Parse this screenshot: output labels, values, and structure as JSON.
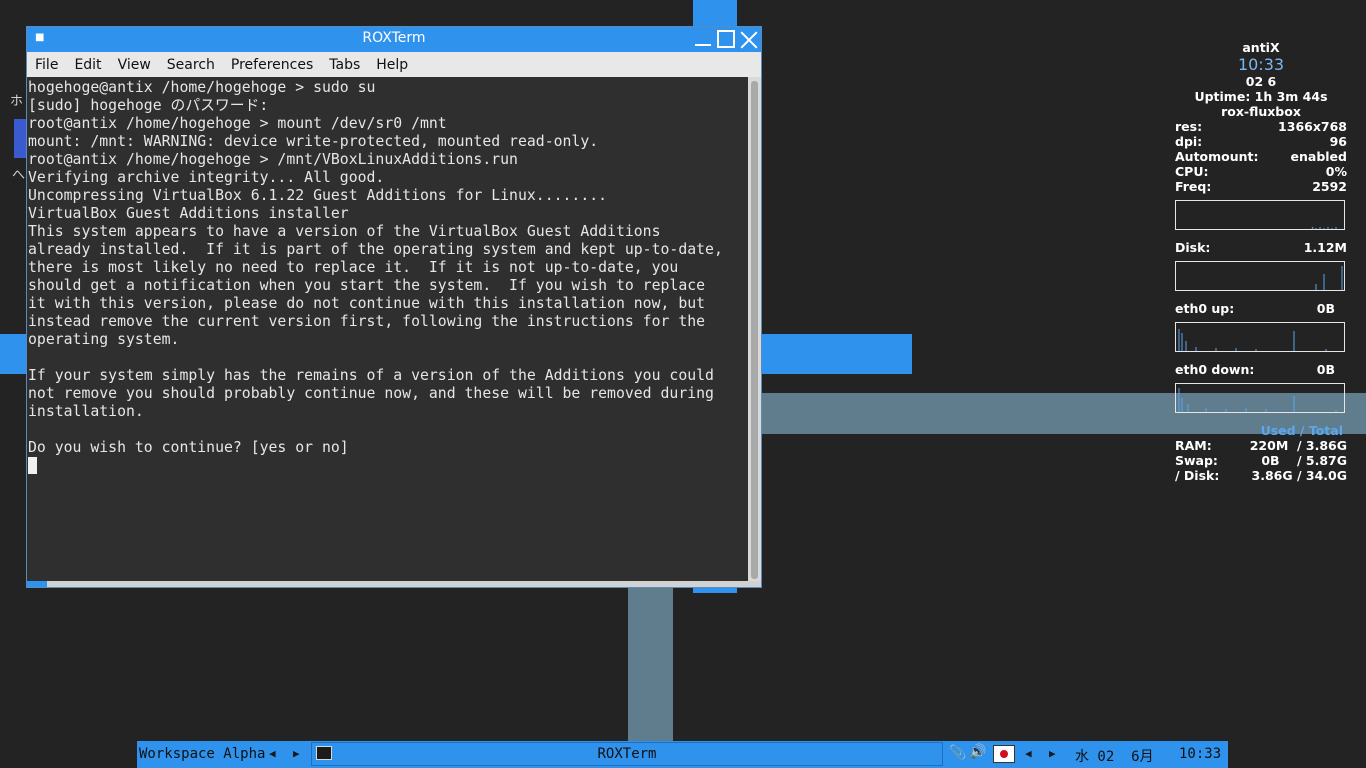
{
  "desktop": {
    "icon_label_1": "ホ",
    "icon_label_2": "へ"
  },
  "window": {
    "title": "ROXTerm",
    "menu": [
      "File",
      "Edit",
      "View",
      "Search",
      "Preferences",
      "Tabs",
      "Help"
    ]
  },
  "terminal": {
    "lines": [
      "hogehoge@antix /home/hogehoge > sudo su",
      "[sudo] hogehoge のパスワード:",
      "root@antix /home/hogehoge > mount /dev/sr0 /mnt",
      "mount: /mnt: WARNING: device write-protected, mounted read-only.",
      "root@antix /home/hogehoge > /mnt/VBoxLinuxAdditions.run",
      "Verifying archive integrity... All good.",
      "Uncompressing VirtualBox 6.1.22 Guest Additions for Linux........",
      "VirtualBox Guest Additions installer",
      "This system appears to have a version of the VirtualBox Guest Additions",
      "already installed.  If it is part of the operating system and kept up-to-date,",
      "there is most likely no need to replace it.  If it is not up-to-date, you",
      "should get a notification when you start the system.  If you wish to replace",
      "it with this version, please do not continue with this installation now, but",
      "instead remove the current version first, following the instructions for the",
      "operating system.",
      "",
      "If your system simply has the remains of a version of the Additions you could",
      "not remove you should probably continue now, and these will be removed during",
      "installation.",
      "",
      "Do you wish to continue? [yes or no]"
    ]
  },
  "conky": {
    "host": "antiX",
    "time": "10:33",
    "date": "02  6",
    "uptime": "Uptime: 1h 3m 44s",
    "wm": "rox-fluxbox",
    "rows": [
      {
        "label": "res:",
        "value": "1366x768"
      },
      {
        "label": "dpi:",
        "value": "96"
      },
      {
        "label": "Automount:",
        "value": "enabled"
      },
      {
        "label": "CPU:",
        "value": "0%"
      },
      {
        "label": "Freq:",
        "value": "2592"
      }
    ],
    "disk": {
      "label": "Disk:",
      "value": "1.12M"
    },
    "eth_up": {
      "label": "eth0 up:",
      "value": "0B"
    },
    "eth_down": {
      "label": "eth0 down:",
      "value": "0B"
    },
    "used_total": "Used / Total",
    "mem": [
      {
        "label": "RAM:",
        "value": "220M  / 3.86G"
      },
      {
        "label": "Swap:",
        "value": "0B    / 5.87G"
      },
      {
        "label": "/ Disk:",
        "value": "3.86G / 34.0G"
      }
    ]
  },
  "taskbar": {
    "workspace": "Workspace Alpha",
    "task_label": "ROXTerm",
    "date_text": "水 02  6月",
    "clock": "10:33"
  }
}
